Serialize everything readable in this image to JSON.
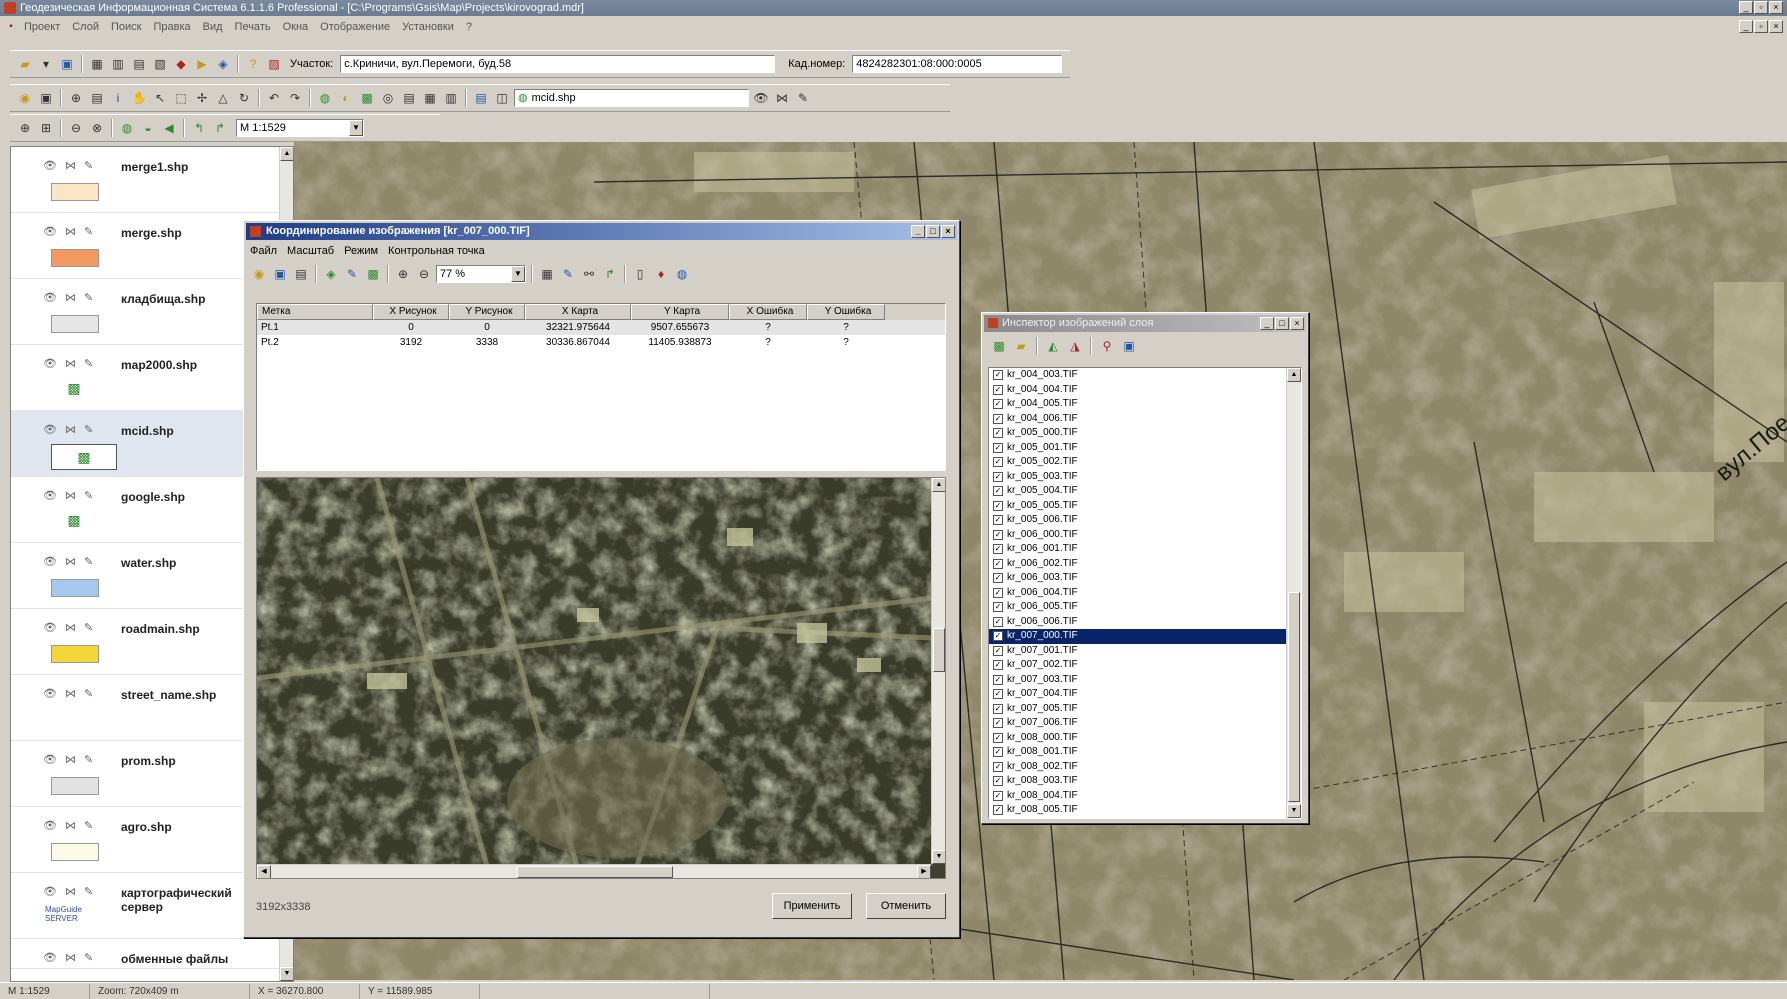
{
  "window": {
    "title": "Геодезическая Информационная Система 6.1.1.6 Professional - [C:\\Programs\\Gsis\\Map\\Projects\\kirovograd.mdr]",
    "menu": [
      "Проект",
      "Слой",
      "Поиск",
      "Правка",
      "Вид",
      "Печать",
      "Окна",
      "Отображение",
      "Установки",
      "?"
    ]
  },
  "toolbar1": {
    "area_label": "Участок:",
    "area_value": "с.Криничи, вул.Перемоги, буд.58",
    "cad_label": "Кад.номер:",
    "cad_value": "4824282301:08:000:0005"
  },
  "toolbar2": {
    "layer_combo": "mcid.shp"
  },
  "toolbar3": {
    "scale_combo": "М 1:1529"
  },
  "layers": [
    {
      "name": "merge1.shp",
      "symbol": "swatch",
      "color": "#fbe6c4"
    },
    {
      "name": "merge.shp",
      "symbol": "swatch",
      "color": "#f29a62"
    },
    {
      "name": "кладбища.shp",
      "symbol": "swatch",
      "color": "#e6e6e6"
    },
    {
      "name": "map2000.shp",
      "symbol": "icon",
      "icon": "green-layer-icon"
    },
    {
      "name": "mcid.shp",
      "symbol": "icon-boxed",
      "icon": "green-layer-icon",
      "selected": true
    },
    {
      "name": "google.shp",
      "symbol": "icon",
      "icon": "green-layer-icon"
    },
    {
      "name": "water.shp",
      "symbol": "swatch",
      "color": "#a6c8ef"
    },
    {
      "name": "roadmain.shp",
      "symbol": "swatch",
      "color": "#f5d638"
    },
    {
      "name": "street_name.shp",
      "symbol": "none"
    },
    {
      "name": "prom.shp",
      "symbol": "swatch",
      "color": "#e2e2e2"
    },
    {
      "name": "agro.shp",
      "symbol": "swatch",
      "color": "#fdfbe8"
    },
    {
      "name": "картографический сервер",
      "symbol": "server"
    },
    {
      "name": "обменные файлы",
      "symbol": "none"
    }
  ],
  "server_logo": "MapGuide SERVER",
  "dialog": {
    "title": "Координирование изображения [kr_007_000.TIF]",
    "menu": [
      "Файл",
      "Масштаб",
      "Режим",
      "Контрольная точка"
    ],
    "zoom": "77 %",
    "columns": [
      "Метка",
      "X Рисунок",
      "Y Рисунок",
      "X Карта",
      "Y Карта",
      "X Ошибка",
      "Y Ошибка"
    ],
    "rows": [
      [
        "Pt.1",
        "0",
        "0",
        "32321.975644",
        "9507.655673",
        "?",
        "?"
      ],
      [
        "Pt.2",
        "3192",
        "3338",
        "30336.867044",
        "11405.938873",
        "?",
        "?"
      ]
    ],
    "dimensions": "3192x3338",
    "apply": "Применить",
    "cancel": "Отменить"
  },
  "inspector": {
    "title": "Инспектор изображений слоя",
    "files": [
      "kr_004_003.TIF",
      "kr_004_004.TIF",
      "kr_004_005.TIF",
      "kr_004_006.TIF",
      "kr_005_000.TIF",
      "kr_005_001.TIF",
      "kr_005_002.TIF",
      "kr_005_003.TIF",
      "kr_005_004.TIF",
      "kr_005_005.TIF",
      "kr_005_006.TIF",
      "kr_006_000.TIF",
      "kr_006_001.TIF",
      "kr_006_002.TIF",
      "kr_006_003.TIF",
      "kr_006_004.TIF",
      "kr_006_005.TIF",
      "kr_006_006.TIF",
      "kr_007_000.TIF",
      "kr_007_001.TIF",
      "kr_007_002.TIF",
      "kr_007_003.TIF",
      "kr_007_004.TIF",
      "kr_007_005.TIF",
      "kr_007_006.TIF",
      "kr_008_000.TIF",
      "kr_008_001.TIF",
      "kr_008_002.TIF",
      "kr_008_003.TIF",
      "kr_008_004.TIF",
      "kr_008_005.TIF"
    ],
    "selected": "kr_007_000.TIF"
  },
  "map_label": "вул.Пое",
  "status": {
    "scale": "М 1:1529",
    "zoom": "Zoom: 720x409 m",
    "x": "X = 36270.800",
    "y": "Y = 11589.985"
  }
}
